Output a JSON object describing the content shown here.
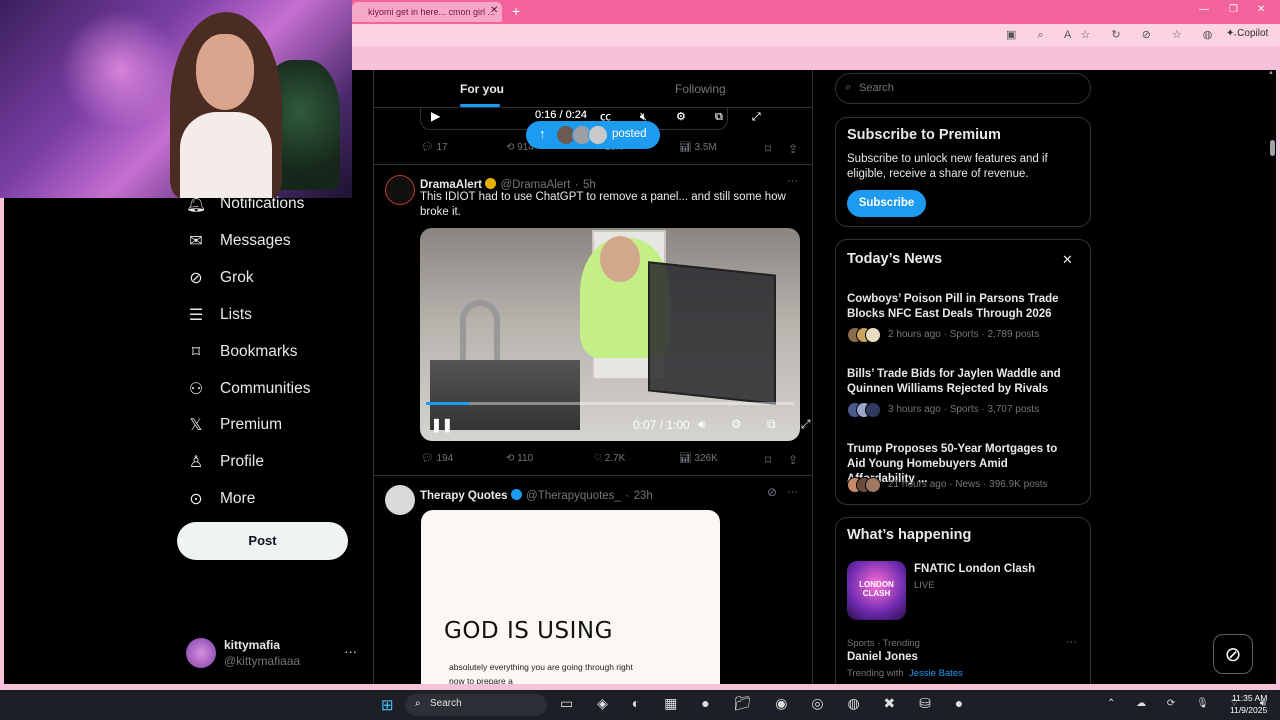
{
  "browser": {
    "tab_title": "kiyomi get in here... cmon girl ...",
    "tab_close": "✕",
    "new_tab": "+",
    "window_controls": [
      "—",
      "❐",
      "✕"
    ],
    "toolbar_icons": "▣ ⌕ A☆ ↻ ⊘ ☆ ◍ ⋯",
    "copilot_label": "Copilot"
  },
  "nav": {
    "items": [
      {
        "label": "Notifications",
        "icon": "bell-icon",
        "glyph": "🔔︎"
      },
      {
        "label": "Messages",
        "icon": "envelope-icon",
        "glyph": "✉"
      },
      {
        "label": "Grok",
        "icon": "grok-icon",
        "glyph": "⊘"
      },
      {
        "label": "Lists",
        "icon": "list-icon",
        "glyph": "☰"
      },
      {
        "label": "Bookmarks",
        "icon": "bookmark-icon",
        "glyph": "⌑"
      },
      {
        "label": "Communities",
        "icon": "communities-icon",
        "glyph": "⚇"
      },
      {
        "label": "Premium",
        "icon": "x-logo-icon",
        "glyph": "𝕏"
      },
      {
        "label": "Profile",
        "icon": "person-icon",
        "glyph": "♙"
      },
      {
        "label": "More",
        "icon": "more-circle-icon",
        "glyph": "⊙"
      }
    ],
    "post_label": "Post",
    "account": {
      "name": "kittymafia",
      "handle": "@kittymafiaaa",
      "more": "···"
    }
  },
  "timeline": {
    "tabs": {
      "for_you": "For you",
      "following": "Following"
    },
    "tweet1": {
      "play": "▶",
      "time": "0:16 / 0:24",
      "player_icons": "㏄ 🔇︎ ⚙ ⧉ ⤢",
      "posted_arrow": "↑",
      "posted_label": "posted",
      "actions": {
        "replies": "17",
        "reposts": "914",
        "likes": "10K",
        "views": "3.5M"
      }
    },
    "tweet2": {
      "name": "DramaAlert",
      "handle": "@DramaAlert",
      "time": "5h",
      "text": "This IDIOT had to use ChatGPT to remove a panel... and still some how broke it.",
      "more": "···",
      "video_time": "0:07 / 1:00",
      "pause": "❚❚",
      "player_icons": "🔊︎ ⚙ ⧉ ⤢",
      "progress": 0.117,
      "actions": {
        "replies": "194",
        "reposts": "110",
        "likes": "2.7K",
        "views": "326K"
      }
    },
    "tweet3": {
      "name": "Therapy Quotes",
      "handle": "@Therapyquotes_",
      "time": "23h",
      "more": "···",
      "grok_glyph": "⊘",
      "card_title": "GOD IS USING",
      "card_body": "absolutely everything you are going through right now to prepare a"
    },
    "icons": {
      "reply": "💬︎",
      "repost": "⟲",
      "like": "♡",
      "views": "📊︎",
      "bookmark": "⌑",
      "share": "⇪"
    }
  },
  "sidebar": {
    "search_placeholder": "Search",
    "premium": {
      "title": "Subscribe to Premium",
      "body": "Subscribe to unlock new features and if eligible, receive a share of revenue.",
      "button": "Subscribe"
    },
    "news": {
      "title": "Today’s News",
      "close": "✕",
      "items": [
        {
          "headline": "Cowboys’ Poison Pill in Parsons Trade Blocks NFC East Deals Through 2026",
          "meta": "2 hours ago · Sports · 2,789 posts"
        },
        {
          "headline": "Bills’ Trade Bids for Jaylen Waddle and Quinnen Williams Rejected by Rivals",
          "meta": "3 hours ago · Sports · 3,707 posts"
        },
        {
          "headline": "Trump Proposes 50-Year Mortgages to Aid Young Homebuyers Amid Affordability ...",
          "meta": "21 hours ago · News · 396.9K posts"
        }
      ]
    },
    "happening": {
      "title": "What’s happening",
      "event_name": "FNATIC London Clash",
      "event_status": "LIVE",
      "thumb_text": "LONDON CLASH",
      "trend_category": "Sports · Trending",
      "trend_name": "Daniel Jones",
      "trend_with_label": "Trending with",
      "trend_with_name": "Jessie Bates",
      "more": "···"
    },
    "grok_fab": "⊘"
  },
  "taskbar": {
    "start": "⊞",
    "search_label": "Search",
    "apps": "▭ ◈ ◐ ▦ ● 📁︎ ◉ ◎ ◍ ✖ ⛁ ●",
    "tray": "⌃ ☁ ⟳ 🎙︎ ⌔ 🔊︎",
    "time": "11:35 AM",
    "date": "11/9/2025"
  },
  "colors": {
    "accent": "#1d9bf0",
    "browser_pink": "#f2649b",
    "x_background": "#000000"
  }
}
